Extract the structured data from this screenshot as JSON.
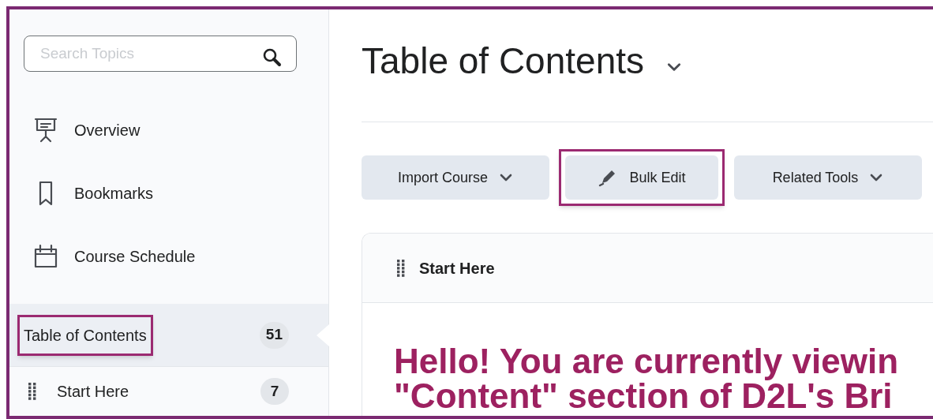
{
  "sidebar": {
    "search": {
      "placeholder": "Search Topics"
    },
    "items": [
      {
        "kind": "overview",
        "label": "Overview"
      },
      {
        "kind": "bookmarks",
        "label": "Bookmarks"
      },
      {
        "kind": "schedule",
        "label": "Course Schedule"
      }
    ],
    "modules": [
      {
        "kind": "toc",
        "label": "Table of Contents",
        "count": "51",
        "selected": true,
        "highlighted": true
      },
      {
        "kind": "module",
        "label": "Start Here",
        "count": "7",
        "selected": false,
        "highlighted": false
      }
    ]
  },
  "main": {
    "title": "Table of Contents",
    "buttons": [
      {
        "label": "Import Course",
        "kind": "dropdown",
        "highlighted": false
      },
      {
        "label": "Bulk Edit",
        "kind": "edit",
        "highlighted": true
      },
      {
        "label": "Related Tools",
        "kind": "dropdown",
        "highlighted": false
      }
    ],
    "module": {
      "title": "Start Here",
      "heading_lines": [
        "Hello! You are currently viewin",
        "\"Content\" section of D2L's Bri"
      ]
    }
  }
}
